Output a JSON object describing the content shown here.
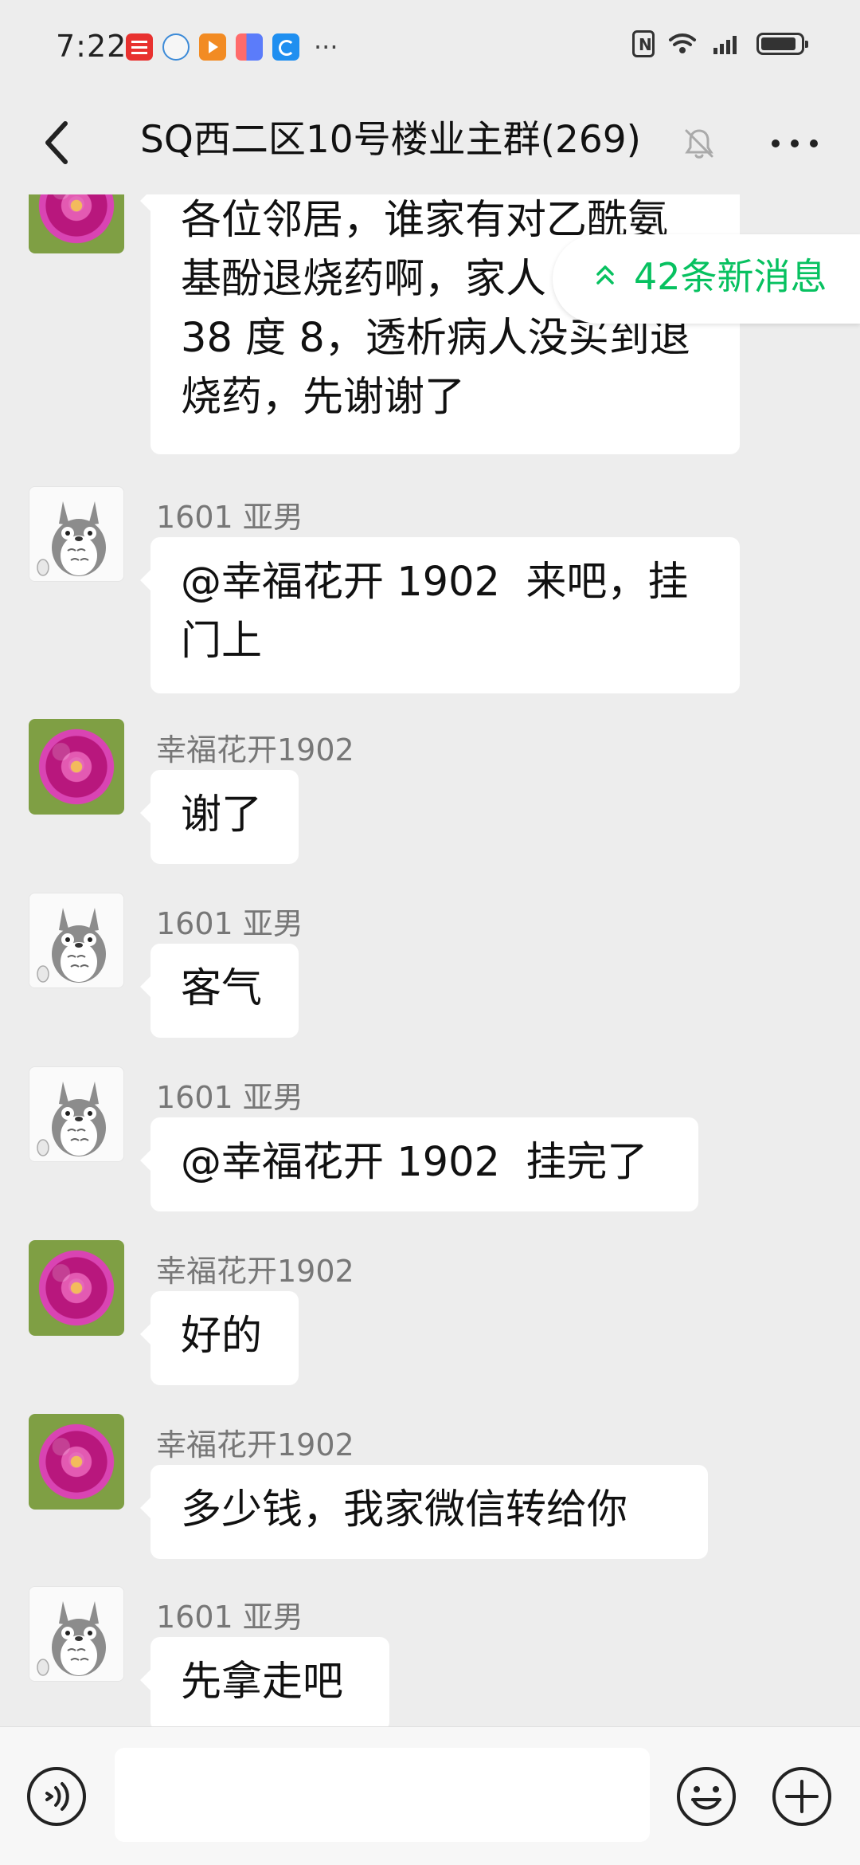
{
  "status": {
    "time": "7:22",
    "apps": [
      "news-app-icon",
      "chat-app-icon",
      "play-app-icon",
      "document-app-icon",
      "edge-app-icon"
    ],
    "more": "···"
  },
  "header": {
    "title": "SQ西二区10号楼业主群(269)"
  },
  "new_messages": {
    "label": "42条新消息"
  },
  "messages": [
    {
      "sender": "",
      "avatar": "flower",
      "text": "各位邻居，谁家有对乙酰氨\n基酚退烧药啊，家人\n38 度 8，透析病人没买到退\n烧药，先谢谢了"
    },
    {
      "sender": "1601 亚男",
      "avatar": "totoro",
      "text": "@幸福花开 1902  来吧，挂\n门上"
    },
    {
      "sender": "幸福花开1902",
      "avatar": "flower",
      "text": "谢了"
    },
    {
      "sender": "1601 亚男",
      "avatar": "totoro",
      "text": "客气"
    },
    {
      "sender": "1601 亚男",
      "avatar": "totoro",
      "text": "@幸福花开 1902  挂完了"
    },
    {
      "sender": "幸福花开1902",
      "avatar": "flower",
      "text": "好的"
    },
    {
      "sender": "幸福花开1902",
      "avatar": "flower",
      "text": "多少钱，我家微信转给你"
    },
    {
      "sender": "1601 亚男",
      "avatar": "totoro",
      "text": "先拿走吧"
    }
  ],
  "input": {
    "value": "",
    "placeholder": ""
  },
  "colors": {
    "background": "#ededed",
    "bubble": "#ffffff",
    "accent": "#07c160",
    "text": "#111111"
  }
}
